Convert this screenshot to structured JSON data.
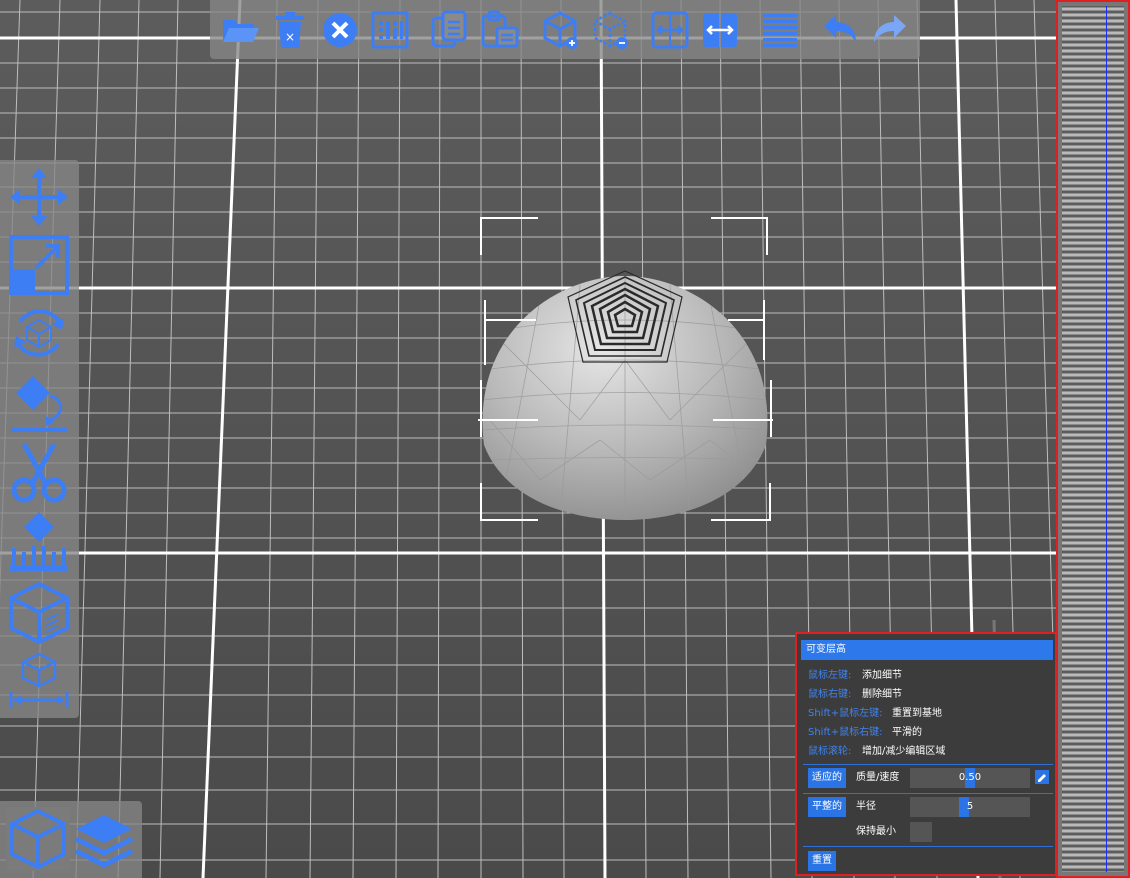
{
  "toolbar": {
    "items": [
      {
        "icon": "open-folder-icon"
      },
      {
        "icon": "delete-trash-icon"
      },
      {
        "icon": "clear-all-icon"
      },
      {
        "icon": "select-all-icon"
      },
      {
        "icon": "copy-icon"
      },
      {
        "icon": "paste-icon"
      },
      {
        "icon": "add-model-icon"
      },
      {
        "icon": "split-model-icon"
      },
      {
        "icon": "arrange-icon"
      },
      {
        "icon": "auto-layout-icon"
      },
      {
        "icon": "layers-icon"
      },
      {
        "icon": "undo-icon"
      },
      {
        "icon": "redo-icon"
      }
    ]
  },
  "left_toolbar": {
    "items": [
      {
        "icon": "move-icon"
      },
      {
        "icon": "scale-icon"
      },
      {
        "icon": "rotate-icon"
      },
      {
        "icon": "lay-flat-icon"
      },
      {
        "icon": "cut-icon"
      },
      {
        "icon": "support-icon"
      },
      {
        "icon": "hollow-icon"
      },
      {
        "icon": "measure-icon"
      }
    ]
  },
  "view_switch": {
    "items": [
      {
        "icon": "model-view-icon",
        "active": true
      },
      {
        "icon": "layer-view-icon",
        "active": false
      }
    ]
  },
  "variable_layer_height": {
    "title": "可变层高",
    "hints": [
      {
        "key": "鼠标左键:",
        "action": "添加细节"
      },
      {
        "key": "鼠标右键:",
        "action": "删除细节"
      },
      {
        "key": "Shift+鼠标左键:",
        "action": "重置到基地"
      },
      {
        "key": "Shift+鼠标右键:",
        "action": "平滑的"
      },
      {
        "key": "鼠标滚轮:",
        "action": "增加/减少编辑区域"
      }
    ],
    "adaptive": {
      "button": "适应的",
      "label": "质量/速度",
      "value": "0.50",
      "level": 0.5
    },
    "smooth": {
      "button": "平整的",
      "label": "半径",
      "value": "5",
      "level": 0.45,
      "keep_label": "保持最小"
    },
    "reset_button": "重置"
  },
  "colors": {
    "accent": "#2a74e6",
    "highlight_border": "#e02020",
    "icon": "#3d7ef5"
  }
}
